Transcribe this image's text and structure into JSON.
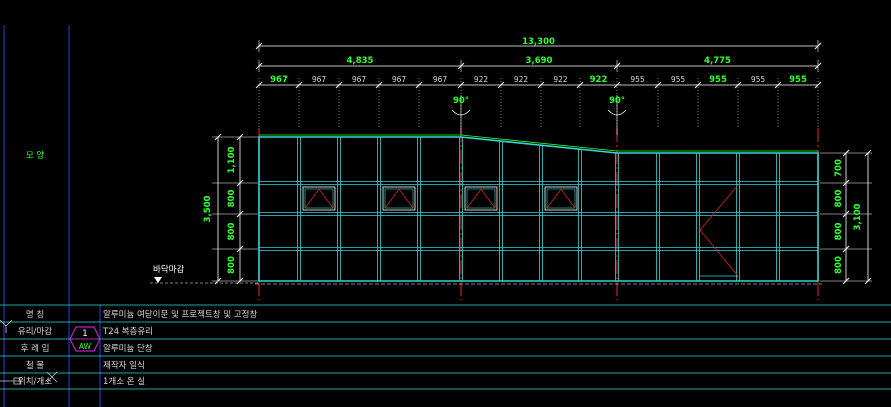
{
  "drawing": {
    "colors": {
      "background": "#000000",
      "frame_cyan": "#35d6d6",
      "dimension_green": "#2eff2e",
      "axis_red": "#d42020",
      "border_blue": "#2030b0",
      "text_white": "#ffffff"
    },
    "side_label": "모       양",
    "dimensions": {
      "total": "13,300",
      "sections": [
        "4,835",
        "3,690",
        "4,775"
      ],
      "top_divisions": [
        {
          "t": "967",
          "bold": true
        },
        {
          "t": "967",
          "bold": false
        },
        {
          "t": "967",
          "bold": false
        },
        {
          "t": "967",
          "bold": false
        },
        {
          "t": "967",
          "bold": false
        },
        {
          "t": "922",
          "bold": false
        },
        {
          "t": "922",
          "bold": false
        },
        {
          "t": "922",
          "bold": false
        },
        {
          "t": "922",
          "bold": true
        },
        {
          "t": "955",
          "bold": false
        },
        {
          "t": "955",
          "bold": false
        },
        {
          "t": "955",
          "bold": true
        },
        {
          "t": "955",
          "bold": false
        },
        {
          "t": "955",
          "bold": true
        }
      ],
      "left_overall": "3,500",
      "left_rows": [
        "1,100",
        "800",
        "800",
        "800"
      ],
      "right_overall": "3,100",
      "right_rows": [
        "700",
        "800",
        "800",
        "800"
      ],
      "angle_1": "90°",
      "angle_2": "90°"
    },
    "floor_label": "바닥마감",
    "table": {
      "rows": [
        {
          "label": "명      칭",
          "value": "알루미늄 여닫이문 및 프로젝트창 및 고정창"
        },
        {
          "label": "유리/마감",
          "value": "T24 복층유리"
        },
        {
          "label": "후 레 임",
          "value": "알루미늄 단창"
        },
        {
          "label": "철      물",
          "value": "제작자 일식"
        },
        {
          "label": "위치/개소",
          "value": "1개소  온 실"
        }
      ],
      "mark_number": "1",
      "mark_code": "AW"
    }
  }
}
